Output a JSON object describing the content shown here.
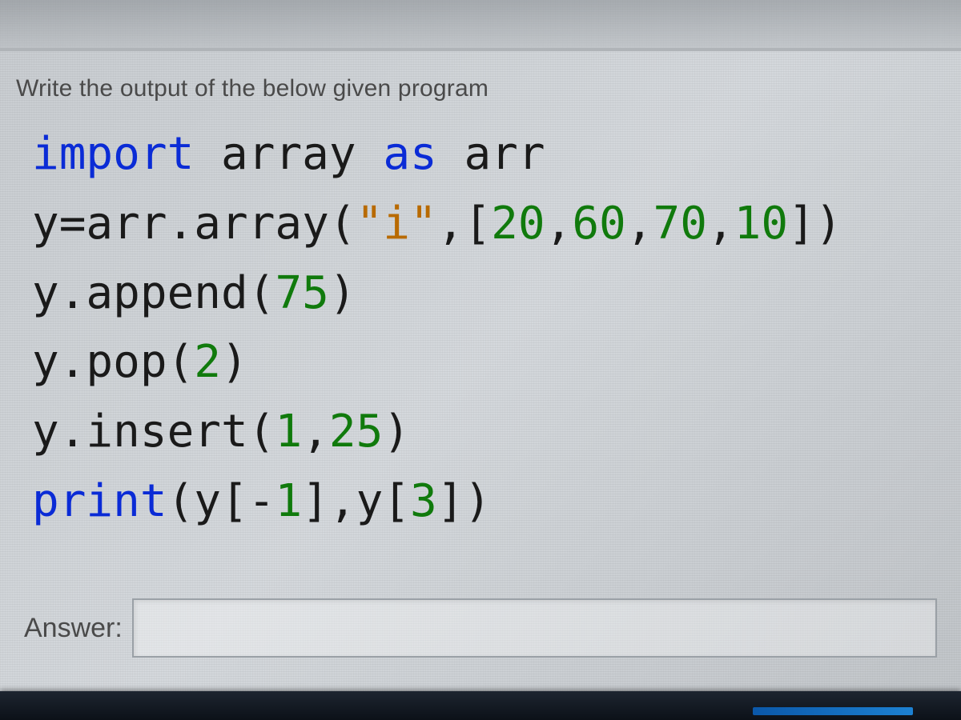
{
  "prompt": "Write the output of the below given program",
  "code": {
    "tokens": [
      [
        {
          "t": "import",
          "c": "kw"
        },
        {
          "t": " array ",
          "c": "plain"
        },
        {
          "t": "as",
          "c": "kw"
        },
        {
          "t": " arr",
          "c": "plain"
        }
      ],
      [
        {
          "t": "y=arr.array(",
          "c": "plain"
        },
        {
          "t": "\"i\"",
          "c": "str"
        },
        {
          "t": ",[",
          "c": "plain"
        },
        {
          "t": "20",
          "c": "num"
        },
        {
          "t": ",",
          "c": "plain"
        },
        {
          "t": "60",
          "c": "num"
        },
        {
          "t": ",",
          "c": "plain"
        },
        {
          "t": "70",
          "c": "num"
        },
        {
          "t": ",",
          "c": "plain"
        },
        {
          "t": "10",
          "c": "num"
        },
        {
          "t": "])",
          "c": "plain"
        }
      ],
      [
        {
          "t": "y.append(",
          "c": "plain"
        },
        {
          "t": "75",
          "c": "num"
        },
        {
          "t": ")",
          "c": "plain"
        }
      ],
      [
        {
          "t": "y.pop(",
          "c": "plain"
        },
        {
          "t": "2",
          "c": "num"
        },
        {
          "t": ")",
          "c": "plain"
        }
      ],
      [
        {
          "t": "y.insert(",
          "c": "plain"
        },
        {
          "t": "1",
          "c": "num"
        },
        {
          "t": ",",
          "c": "plain"
        },
        {
          "t": "25",
          "c": "num"
        },
        {
          "t": ")",
          "c": "plain"
        }
      ],
      [
        {
          "t": "print",
          "c": "kw"
        },
        {
          "t": "(y[-",
          "c": "plain"
        },
        {
          "t": "1",
          "c": "num"
        },
        {
          "t": "],y[",
          "c": "plain"
        },
        {
          "t": "3",
          "c": "num"
        },
        {
          "t": "])",
          "c": "plain"
        }
      ]
    ]
  },
  "answer": {
    "label": "Answer:",
    "value": ""
  }
}
